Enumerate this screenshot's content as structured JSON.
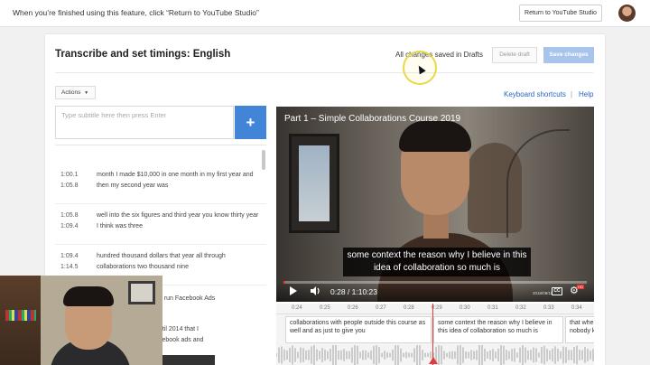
{
  "topbar": {
    "notice": "When you’re finished using this feature, click “Return to YouTube Studio”",
    "return_label": "Return to YouTube Studio"
  },
  "editor": {
    "title": "Transcribe and set timings: English",
    "status": "All changes saved in Drafts",
    "delete_label": "Delete draft",
    "save_label": "Save changes",
    "actions_label": "Actions",
    "shortcuts_label": "Keyboard shortcuts",
    "separator": "|",
    "help_label": "Help"
  },
  "input": {
    "placeholder": "Type subtitle here then press Enter",
    "add_symbol": "+"
  },
  "subtitles": [
    {
      "start": "1:00.1",
      "end": "1:05.8",
      "text": "month I made $10,000 in one month in my first year and then my second year was"
    },
    {
      "start": "1:05.8",
      "end": "1:09.4",
      "text": "well into the six figures and third year you know thirty year I think was three"
    },
    {
      "start": "1:09.4",
      "end": "1:14.5",
      "text": "hundred thousand dollars that year all through collaborations two thousand nine"
    }
  ],
  "partial_rows": {
    "row4": "o run Facebook Ads",
    "row5_line1": "ntil 2014 that I",
    "row5_line2": "cebook ads and"
  },
  "video": {
    "title": "Part 1 – Simple Collaborations Course 2019",
    "caption": "some context the reason why I believe in this idea of collaboration so much is",
    "time": "0:28 / 1:10:23",
    "progress": 0.0066,
    "cc_label": "CC",
    "hd_label": "HD",
    "datestamp": "2018/08/11"
  },
  "timeline": {
    "ticks": [
      "0:24",
      "0:25",
      "0:26",
      "0:27",
      "0:28",
      "0:29",
      "0:30",
      "0:31",
      "0:32",
      "0:33",
      "0:34"
    ],
    "segments": [
      "collaborations with people outside this course as well and as just to give you",
      "some context the reason why I believe in this idea of collaboration so much is",
      "that whe nobody k"
    ]
  }
}
